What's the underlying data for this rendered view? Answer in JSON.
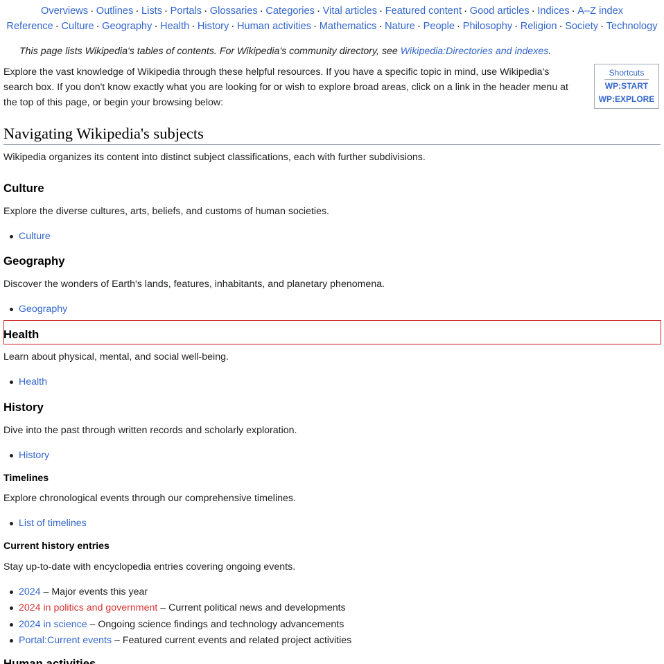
{
  "nav": {
    "row1": [
      "Overviews",
      "Outlines",
      "Lists",
      "Portals",
      "Glossaries",
      "Categories",
      "Vital articles",
      "Featured content",
      "Good articles",
      "Indices",
      "A–Z index"
    ],
    "row2": [
      "Reference",
      "Culture",
      "Geography",
      "Health",
      "History",
      "Human activities",
      "Mathematics",
      "Nature",
      "People",
      "Philosophy",
      "Religion",
      "Society",
      "Technology"
    ],
    "separator": "·"
  },
  "hatnote": {
    "text": "This page lists Wikipedia's tables of contents. For Wikipedia's community directory, see",
    "link": "Wikipedia:Directories and indexes",
    "end": "."
  },
  "intro": {
    "text": "Explore the vast knowledge of Wikipedia through these helpful resources. If you have a specific topic in mind, use Wikipedia's search box. If you don't know exactly what you are looking for or wish to explore broad areas, click on a link in the header menu at the top of this page, or begin your browsing below:"
  },
  "shortcuts": {
    "title": "Shortcuts",
    "items": [
      "WP:START",
      "WP:EXPLORE"
    ]
  },
  "section": {
    "title": "Navigating Wikipedia's subjects",
    "description": "Wikipedia organizes its content into distinct subject classifications, each with further subdivisions."
  },
  "culture": {
    "heading": "Culture",
    "description": "Explore the diverse cultures, arts, beliefs, and customs of human societies.",
    "link": "Culture"
  },
  "geography": {
    "heading": "Geography",
    "description": "Discover the wonders of Earth's lands, features, inhabitants, and planetary phenomena.",
    "link": "Geography"
  },
  "health": {
    "heading": "Health",
    "description": "Learn about physical, mental, and social well-being.",
    "link": "Health"
  },
  "history": {
    "heading": "History",
    "description": "Dive into the past through written records and scholarly exploration.",
    "link": "History"
  },
  "timelines": {
    "heading": "Timelines",
    "description": "Explore chronological events through our comprehensive timelines.",
    "link": "List of timelines"
  },
  "current": {
    "heading": "Current history entries",
    "description": "Stay up-to-date with encyclopedia entries covering ongoing events.",
    "items": [
      {
        "link": "2024",
        "text": " – Major events this year"
      },
      {
        "link": "2024 in politics and government",
        "text": " – Current political news and developments"
      },
      {
        "link": "2024 in science",
        "text": " – Ongoing science findings and technology advancements"
      },
      {
        "link": "Portal:Current events",
        "text": " – Featured current events and related project activities"
      }
    ]
  },
  "next_heading": "Human activities",
  "colors": {
    "link": "#3366cc",
    "redlink": "#d73333",
    "highlight": "#cc2222",
    "text": "#202122"
  }
}
